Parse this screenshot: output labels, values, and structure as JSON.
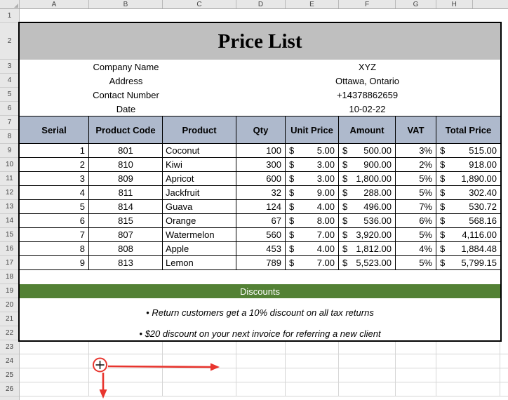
{
  "columns": [
    "A",
    "B",
    "C",
    "D",
    "E",
    "F",
    "G",
    "H"
  ],
  "row_numbers": [
    "1",
    "2",
    "3",
    "4",
    "5",
    "6",
    "7",
    "8",
    "9",
    "10",
    "11",
    "12",
    "13",
    "14",
    "15",
    "16",
    "17",
    "18",
    "19",
    "20",
    "21",
    "22",
    "23",
    "24",
    "25",
    "26"
  ],
  "title": "Price List",
  "info": {
    "rows": [
      {
        "label": "Company Name",
        "value": "XYZ"
      },
      {
        "label": "Address",
        "value": "Ottawa, Ontario"
      },
      {
        "label": "Contact Number",
        "value": "+14378862659"
      },
      {
        "label": "Date",
        "value": "10-02-22"
      }
    ]
  },
  "table": {
    "currency": "$",
    "headers": [
      "Serial",
      "Product Code",
      "Product",
      "Qty",
      "Unit Price",
      "Amount",
      "VAT",
      "Total Price"
    ],
    "rows": [
      {
        "serial": "1",
        "code": "801",
        "product": "Coconut",
        "qty": "100",
        "unit_price": "5.00",
        "amount": "500.00",
        "vat": "3%",
        "total": "515.00"
      },
      {
        "serial": "2",
        "code": "810",
        "product": "Kiwi",
        "qty": "300",
        "unit_price": "3.00",
        "amount": "900.00",
        "vat": "2%",
        "total": "918.00"
      },
      {
        "serial": "3",
        "code": "809",
        "product": "Apricot",
        "qty": "600",
        "unit_price": "3.00",
        "amount": "1,800.00",
        "vat": "5%",
        "total": "1,890.00"
      },
      {
        "serial": "4",
        "code": "811",
        "product": "Jackfruit",
        "qty": "32",
        "unit_price": "9.00",
        "amount": "288.00",
        "vat": "5%",
        "total": "302.40"
      },
      {
        "serial": "5",
        "code": "814",
        "product": "Guava",
        "qty": "124",
        "unit_price": "4.00",
        "amount": "496.00",
        "vat": "7%",
        "total": "530.72"
      },
      {
        "serial": "6",
        "code": "815",
        "product": "Orange",
        "qty": "67",
        "unit_price": "8.00",
        "amount": "536.00",
        "vat": "6%",
        "total": "568.16"
      },
      {
        "serial": "7",
        "code": "807",
        "product": "Watermelon",
        "qty": "560",
        "unit_price": "7.00",
        "amount": "3,920.00",
        "vat": "5%",
        "total": "4,116.00"
      },
      {
        "serial": "8",
        "code": "808",
        "product": "Apple",
        "qty": "453",
        "unit_price": "4.00",
        "amount": "1,812.00",
        "vat": "4%",
        "total": "1,884.48"
      },
      {
        "serial": "9",
        "code": "813",
        "product": "Lemon",
        "qty": "789",
        "unit_price": "7.00",
        "amount": "5,523.00",
        "vat": "5%",
        "total": "5,799.15"
      }
    ]
  },
  "discounts": {
    "title": "Discounts",
    "bullets": [
      "• Return customers get a 10% discount on all tax returns",
      "• $20 discount on your next invoice for referring a new client"
    ]
  },
  "colors": {
    "title_bg": "#BFBFBF",
    "table_header_bg": "#AEB9CC",
    "discount_bg": "#538135",
    "annotation_red": "#E8352E",
    "grid_line": "#D6D6D6",
    "header_bg": "#E7E7E7"
  }
}
